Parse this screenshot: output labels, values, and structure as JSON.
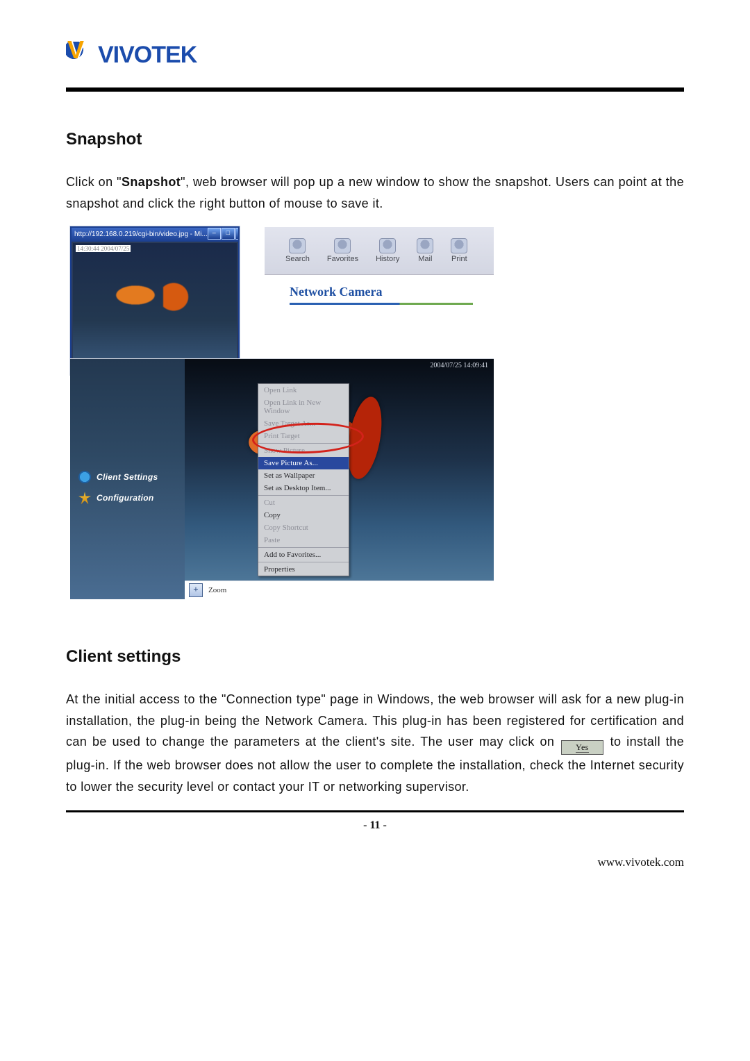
{
  "logo": {
    "text": "VIVOTEK"
  },
  "sections": {
    "snapshot": {
      "title": "Snapshot",
      "p1_pre": "Click on \"",
      "p1_bold": "Snapshot",
      "p1_post": "\", web browser will pop up a new window to show the snapshot. Users can point at the snapshot and click the right button of mouse to save it."
    },
    "client": {
      "title": "Client settings",
      "p_pre": "At the initial access to the \"Connection type\" page in Windows, the web browser will ask for a new plug-in installation, the plug-in being the Network Camera. This plug-in has been registered for certification and can be used to change the parameters at the client's site. The user may click on",
      "yes": "Yes",
      "p_post": "to install the plug-in. If the web browser does not allow the user to complete the installation, check the Internet security to lower the security level or contact your IT or networking supervisor."
    }
  },
  "screenshot": {
    "ie_title": "http://192.168.0.219/cgi-bin/video.jpg - Mi...",
    "overlay_time": "14:30:44  2004/07/25",
    "ribbon": {
      "search": "Search",
      "favorites": "Favorites",
      "history": "History",
      "mail": "Mail",
      "print": "Print"
    },
    "brand": "Network Camera",
    "sidebar": {
      "client": "Client Settings",
      "config": "Configuration"
    },
    "stamp": "2004/07/25 14:09:41",
    "zoom": {
      "plus": "+",
      "label": "Zoom"
    },
    "context": {
      "open": "Open Link",
      "open_new": "Open Link in New Window",
      "save_target": "Save Target As...",
      "print_target": "Print Target",
      "show_picture": "Show Picture",
      "save_picture": "Save Picture As...",
      "wallpaper": "Set as Wallpaper",
      "desktop": "Set as Desktop Item...",
      "cut": "Cut",
      "copy": "Copy",
      "copy_shortcut": "Copy Shortcut",
      "paste": "Paste",
      "add_fav": "Add to Favorites...",
      "props": "Properties"
    }
  },
  "footer": {
    "page": "- 11 -",
    "url": "www.vivotek.com"
  }
}
